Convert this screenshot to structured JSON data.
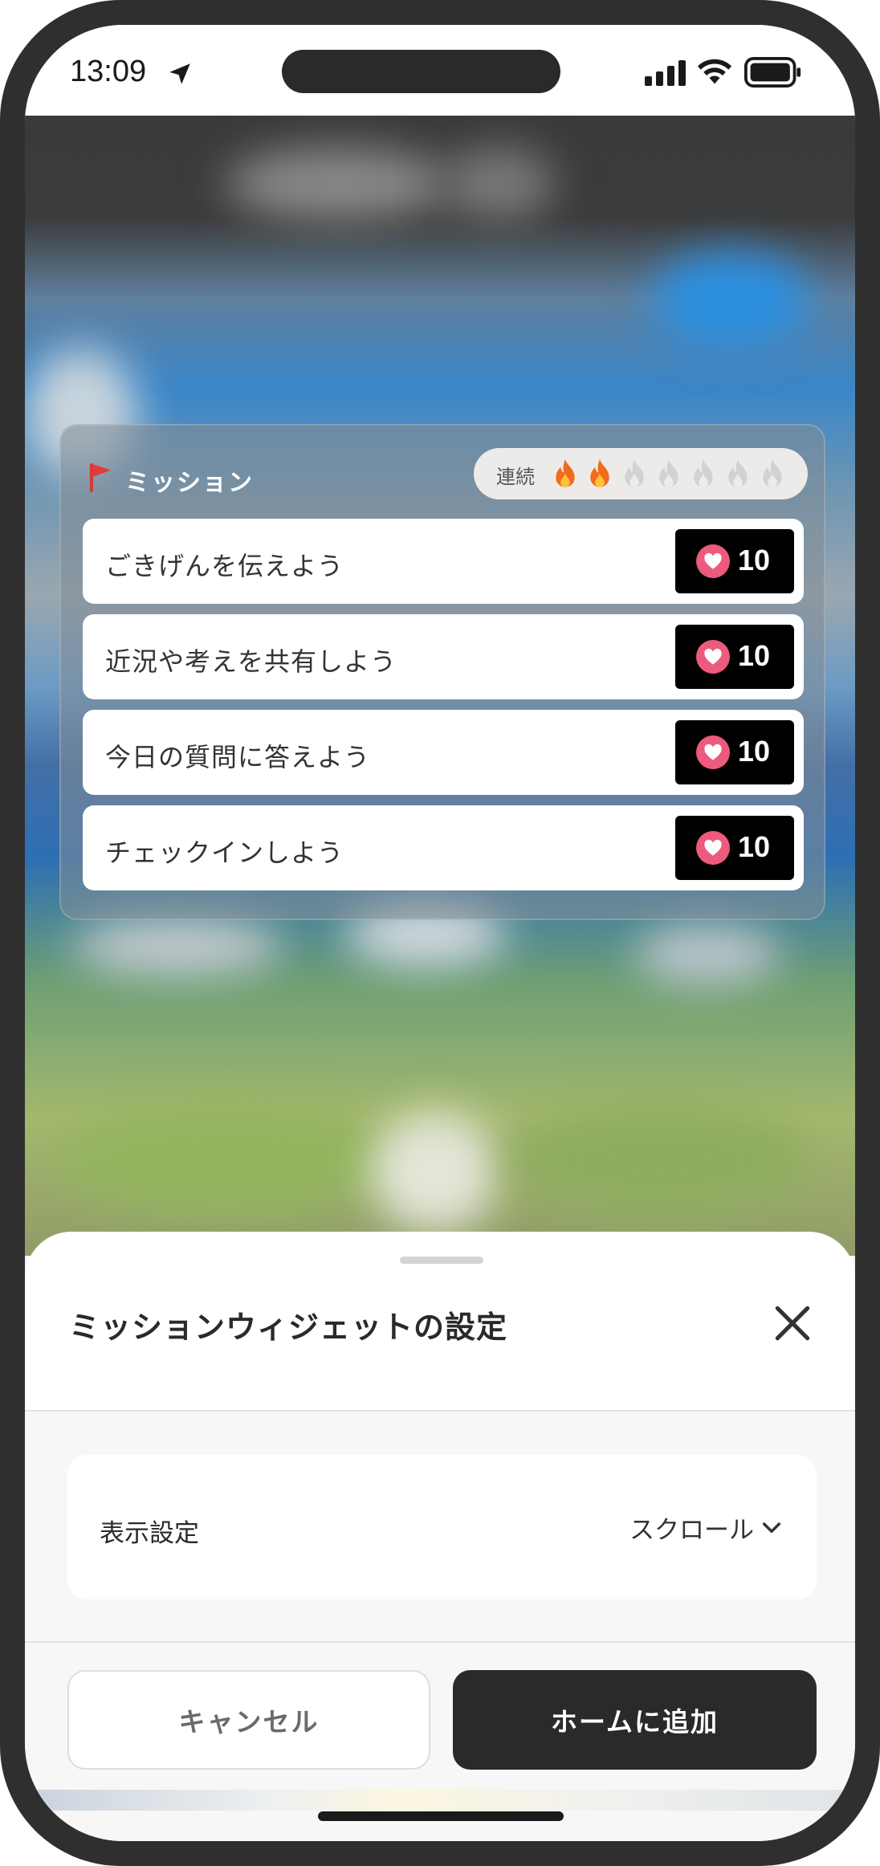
{
  "status_bar": {
    "time": "13:09"
  },
  "widget": {
    "title": "ミッション",
    "streak_label": "連続",
    "streak": {
      "active": 2,
      "total": 7
    },
    "missions": [
      {
        "label": "ごきげんを伝えよう",
        "reward": "10"
      },
      {
        "label": "近況や考えを共有しよう",
        "reward": "10"
      },
      {
        "label": "今日の質問に答えよう",
        "reward": "10"
      },
      {
        "label": "チェックインしよう",
        "reward": "10"
      }
    ]
  },
  "sheet": {
    "title": "ミッションウィジェットの設定",
    "setting": {
      "label": "表示設定",
      "value": "スクロール"
    },
    "cancel_label": "キャンセル",
    "add_label": "ホームに追加"
  },
  "colors": {
    "flame_active": "#f26a1b",
    "flame_inactive": "#d2d2d2",
    "reward_bg": "#000000",
    "heart": "#ec5a7c",
    "primary_button": "#2a2a2a"
  },
  "icons": [
    "location-arrow-icon",
    "signal-icon",
    "wifi-icon",
    "battery-icon",
    "flag-icon",
    "flame-icon",
    "heart-icon",
    "close-icon",
    "chevron-down-icon"
  ]
}
